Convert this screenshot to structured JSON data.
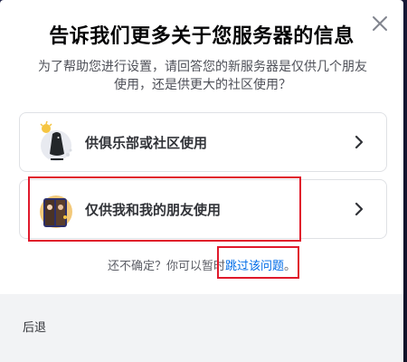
{
  "modal": {
    "title": "告诉我们更多关于您服务器的信息",
    "subtitle": "为了帮助您进行设置，请回答您的新服务器是仅供几个朋友使用，还是供更大的社区使用？"
  },
  "options": [
    {
      "label": "供俱乐部或社区使用",
      "icon": "club-community-icon"
    },
    {
      "label": "仅供我和我的朋友使用",
      "icon": "friends-icon"
    }
  ],
  "skip": {
    "prefix": "还不确定？你可以暂时",
    "link": "跳过该问题",
    "suffix": "。"
  },
  "footer": {
    "back_label": "后退"
  },
  "colors": {
    "link": "#006ce7",
    "highlight": "#e0192b",
    "footer_bg": "#f2f3f5"
  }
}
